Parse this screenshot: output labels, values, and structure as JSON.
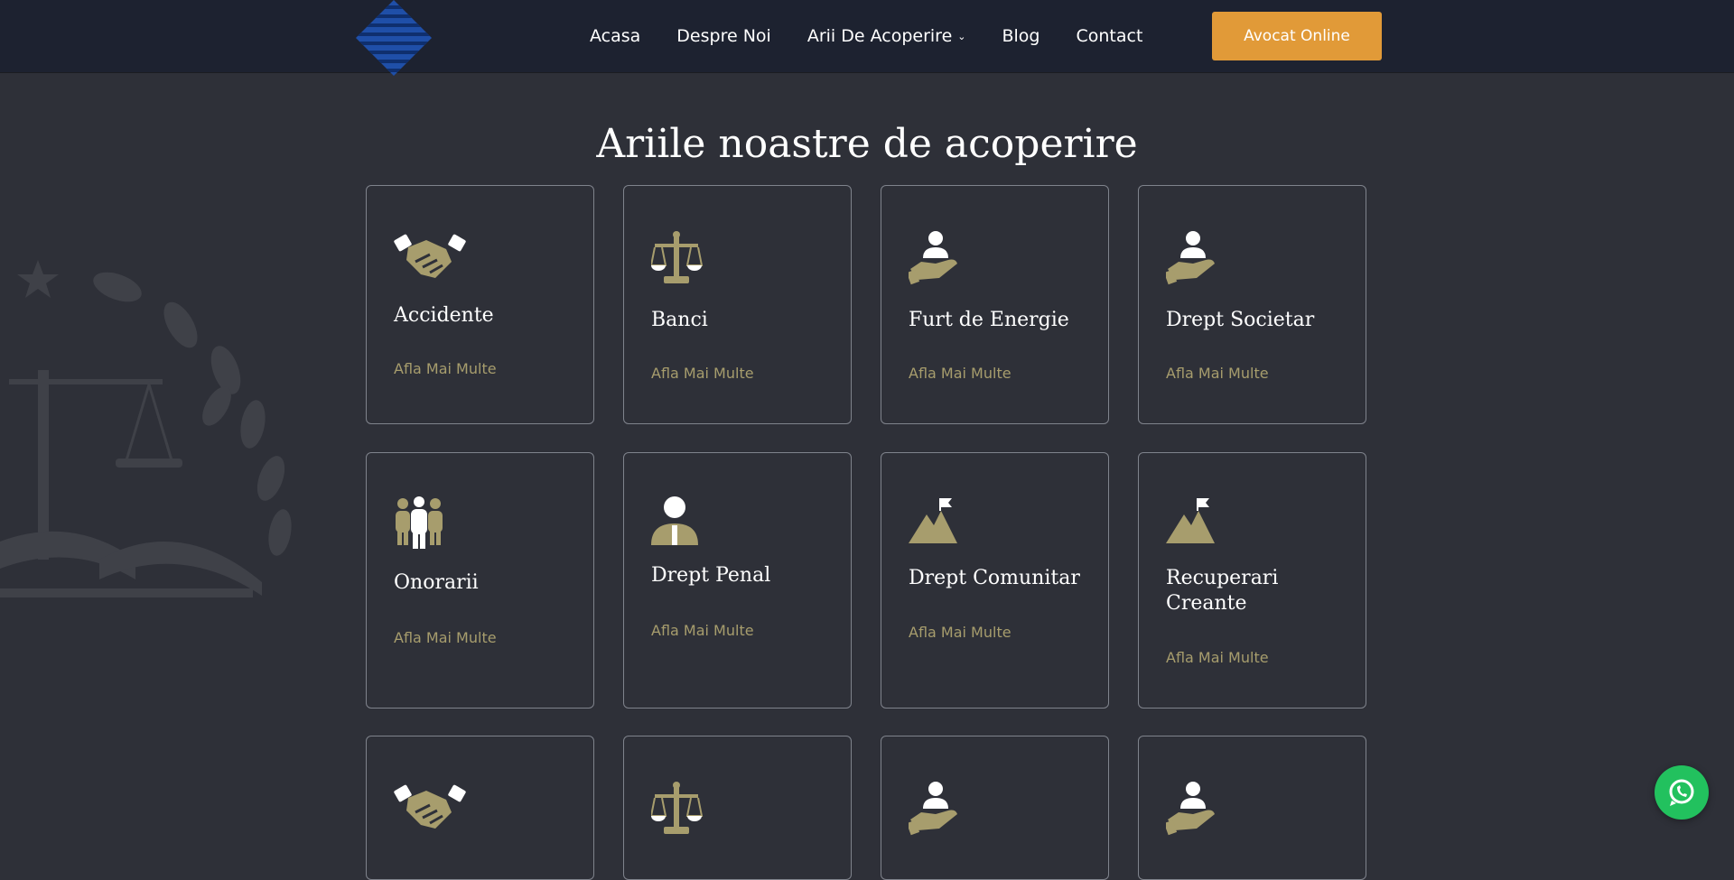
{
  "brand": {
    "accent": "#e19a38",
    "gold": "#a79d6d",
    "header_bg": "#1d2230",
    "page_bg": "#2e3038"
  },
  "nav": {
    "items": [
      "Acasa",
      "Despre Noi",
      "Arii De Acoperire",
      "Blog",
      "Contact"
    ],
    "dropdown_index": 2,
    "cta_label": "Avocat Online"
  },
  "section": {
    "title": "Ariile noastre de acoperire"
  },
  "cards": [
    {
      "title": "Accidente",
      "link": "Afla Mai Multe",
      "icon": "handshake-icon"
    },
    {
      "title": "Banci",
      "link": "Afla Mai Multe",
      "icon": "scales-icon"
    },
    {
      "title": "Furt de Energie",
      "link": "Afla Mai Multe",
      "icon": "hand-person-icon"
    },
    {
      "title": "Drept Societar",
      "link": "Afla Mai Multe",
      "icon": "hand-person-icon"
    },
    {
      "title": "Onorarii",
      "link": "Afla Mai Multe",
      "icon": "group-icon"
    },
    {
      "title": "Drept Penal",
      "link": "Afla Mai Multe",
      "icon": "lawyer-icon"
    },
    {
      "title": "Drept Comunitar",
      "link": "Afla Mai Multe",
      "icon": "mountain-flag-icon"
    },
    {
      "title": "Recuperari Creante",
      "link": "Afla Mai Multe",
      "icon": "mountain-flag-icon"
    },
    {
      "title": "",
      "link": "",
      "icon": "handshake-icon"
    },
    {
      "title": "",
      "link": "",
      "icon": "scales-icon"
    },
    {
      "title": "",
      "link": "",
      "icon": "hand-person-icon"
    },
    {
      "title": "",
      "link": "",
      "icon": "hand-person-icon"
    }
  ],
  "whatsapp": {
    "icon": "whatsapp-icon"
  }
}
